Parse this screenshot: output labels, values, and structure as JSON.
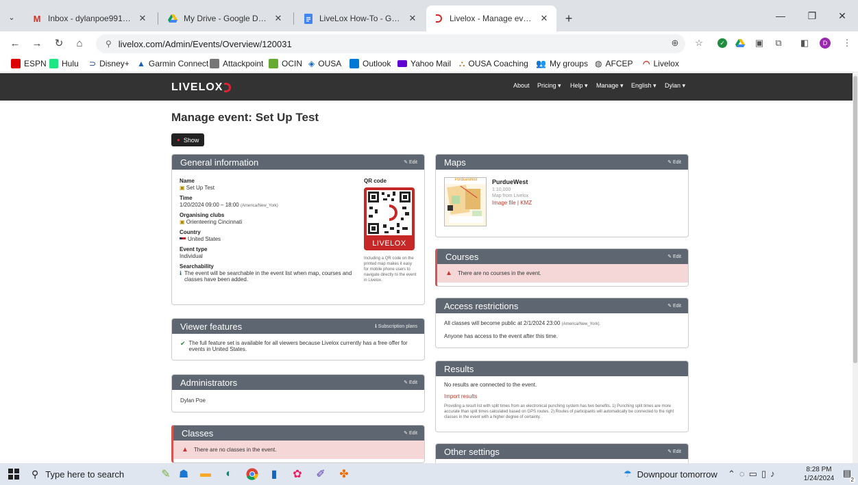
{
  "browser": {
    "tabs": [
      {
        "title": "Inbox - dylanpoe9917@gmail.c",
        "icon": "gmail-icon"
      },
      {
        "title": "My Drive - Google Drive",
        "icon": "google-drive-icon"
      },
      {
        "title": "LiveLox How-To - Google Docs",
        "icon": "google-docs-icon"
      },
      {
        "title": "Livelox - Manage event: Set Up",
        "icon": "livelox-icon",
        "active": true
      }
    ],
    "new_tab": "+",
    "url_site_icon": "⚲",
    "url": "livelox.com/Admin/Events/Overview/120031",
    "profile_initial": "D",
    "bookmarks": [
      "ESPN",
      "Hulu",
      "Disney+",
      "Garmin Connect",
      "Attackpoint",
      "OCIN",
      "OUSA",
      "Outlook",
      "Yahoo Mail",
      "OUSA Coaching",
      "My groups",
      "AFCEP",
      "Livelox"
    ]
  },
  "site": {
    "logo": "LIVELOX",
    "nav": [
      "About",
      "Pricing ▾",
      "Help ▾",
      "Manage ▾",
      "English ▾",
      "Dylan ▾"
    ]
  },
  "page": {
    "title": "Manage event: Set Up Test",
    "show_button": "Show",
    "edit_label": "Edit"
  },
  "general": {
    "title": "General information",
    "name_label": "Name",
    "name": "Set Up Test",
    "time_label": "Time",
    "time": "1/20/2024 09:00 – 18:00",
    "time_zone": "(America/New_York)",
    "clubs_label": "Organising clubs",
    "club": "Orienteering Cincinnati",
    "country_label": "Country",
    "country": "United States",
    "event_type_label": "Event type",
    "event_type": "Individual",
    "searchability_label": "Searchability",
    "searchability": "The event will be searchable in the event list when map, courses and classes have been added.",
    "qr_label": "QR code",
    "qr_brand": "LIVELOX",
    "qr_note": "Including a QR code on the printed map makes it easy for mobile phone users to navigate directly to the event in Livelox."
  },
  "viewer": {
    "title": "Viewer features",
    "link": "Subscription plans",
    "text": "The full feature set is available for all viewers because Livelox currently has a free offer for events in United States."
  },
  "admins": {
    "title": "Administrators",
    "name": "Dylan Poe"
  },
  "classes": {
    "title": "Classes",
    "alert": "There are no classes in the event."
  },
  "maps": {
    "title": "Maps",
    "thumb_label": "PurdueWest",
    "name": "PurdueWest",
    "scale": "1:10,000",
    "source": "Map from Livelox",
    "links": "Image file | KMZ"
  },
  "courses": {
    "title": "Courses",
    "alert": "There are no courses in the event."
  },
  "access": {
    "title": "Access restrictions",
    "line1": "All classes will become public at 2/1/2024 23:00",
    "line1_tz": "(America/New_York).",
    "line2": "Anyone has access to the event after this time."
  },
  "results": {
    "title": "Results",
    "line1": "No results are connected to the event.",
    "import": "Import results",
    "note": "Providing a result list with split times from an electronical punching system has two benefits. 1) Punching split times are more accurate than split times calculated based on GPS routes. 2) Routes of participants will automatically be connected to the right classes in the event with a higher degree of certainty."
  },
  "other": {
    "title": "Other settings"
  },
  "taskbar": {
    "search_placeholder": "Type here to search",
    "weather": "Downpour tomorrow",
    "time": "8:28 PM",
    "date": "1/24/2024",
    "notif_count": "2"
  },
  "colors": {
    "panel_header": "#5d6671",
    "site_header": "#333333",
    "error_bg": "#f5d7d7",
    "accent_red": "#d22233"
  }
}
